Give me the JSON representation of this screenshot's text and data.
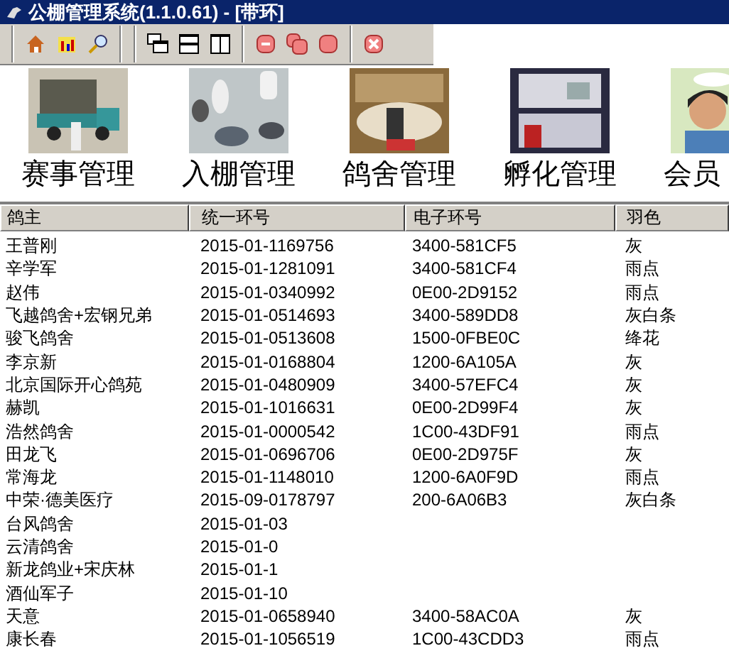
{
  "window": {
    "title": "公棚管理系统(1.1.0.61) - [带环]"
  },
  "nav": [
    {
      "label": "赛事管理"
    },
    {
      "label": "入棚管理"
    },
    {
      "label": "鸽舍管理"
    },
    {
      "label": "孵化管理"
    },
    {
      "label": "会员"
    }
  ],
  "table": {
    "columns": [
      "鸽主",
      "统一环号",
      "电子环号",
      "羽色"
    ],
    "rows": [
      [
        "王普刚",
        "2015-01-1169756",
        "3400-581CF5",
        "灰"
      ],
      [
        "辛学军",
        "2015-01-1281091",
        "3400-581CF4",
        "雨点"
      ],
      [
        "赵伟",
        "2015-01-0340992",
        "0E00-2D9152",
        "雨点"
      ],
      [
        "飞越鸽舍+宏钢兄弟",
        "2015-01-0514693",
        "3400-589DD8",
        "灰白条"
      ],
      [
        "骏飞鸽舍",
        "2015-01-0513608",
        "1500-0FBE0C",
        "绛花"
      ],
      [
        "李京新",
        "2015-01-0168804",
        "1200-6A105A",
        "灰"
      ],
      [
        "北京国际开心鸽苑",
        "2015-01-0480909",
        "3400-57EFC4",
        "灰"
      ],
      [
        "赫凯",
        "2015-01-1016631",
        "0E00-2D99F4",
        "灰"
      ],
      [
        "浩然鸽舍",
        "2015-01-0000542",
        "1C00-43DF91",
        "雨点"
      ],
      [
        "田龙飞",
        "2015-01-0696706",
        "0E00-2D975F",
        "灰"
      ],
      [
        "常海龙",
        "2015-01-1148010",
        "1200-6A0F9D",
        "雨点"
      ],
      [
        "中荣·德美医疗",
        "2015-09-0178797",
        "200-6A06B3",
        "灰白条"
      ],
      [
        "台风鸽舍",
        "2015-01-03"
      ],
      [
        "云清鸽舍",
        "2015-01-0"
      ],
      [
        "新龙鸽业+宋庆林",
        "2015-01-1"
      ],
      [
        "酒仙军子",
        "2015-01-10"
      ],
      [
        "天意",
        "2015-01-0658940",
        "3400-58AC0A",
        "灰"
      ],
      [
        "康长春",
        "2015-01-1056519",
        "1C00-43CDD3",
        "雨点"
      ]
    ]
  }
}
